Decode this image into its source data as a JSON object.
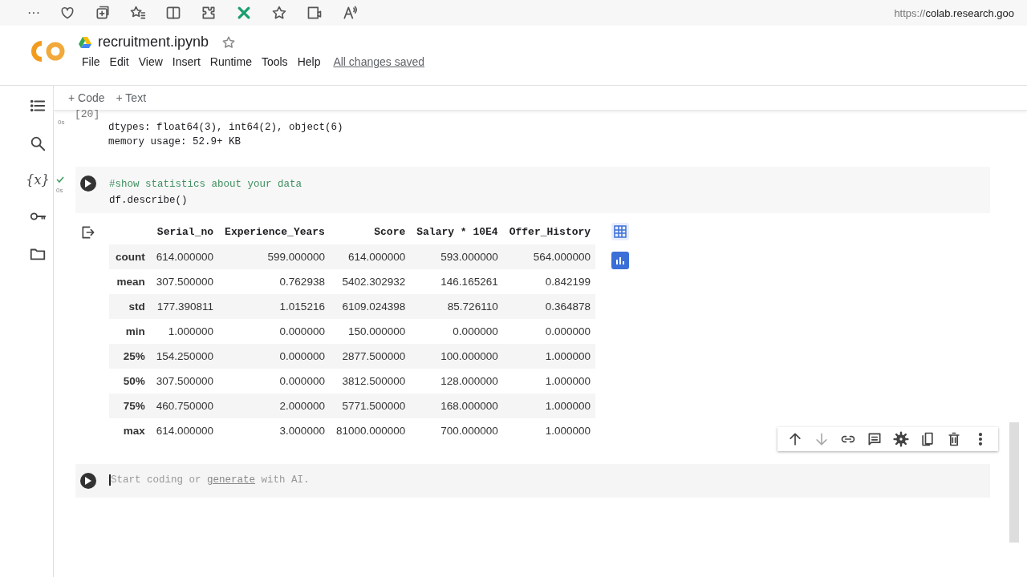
{
  "browser": {
    "menu_glyph": "···",
    "url_scheme": "https://",
    "url_host": "colab.research.goo"
  },
  "notebook": {
    "title": "recruitment.ipynb",
    "menu": [
      "File",
      "Edit",
      "View",
      "Insert",
      "Runtime",
      "Tools",
      "Help"
    ],
    "save_status": "All changes saved"
  },
  "sidebar": {
    "variables_glyph": "{x}"
  },
  "toolbar": [
    "+ Code",
    "+ Text"
  ],
  "prev_cell": {
    "exec_count": "[20]",
    "time": "0s",
    "lines": [
      "dtypes: float64(3), int64(2), object(6)",
      "memory usage: 52.9+ KB"
    ]
  },
  "code_cell": {
    "ran": true,
    "time": "0s",
    "comment": "#show statistics about your data",
    "code": "df.describe()",
    "table": {
      "columns": [
        "Serial_no",
        "Experience_Years",
        "Score",
        "Salary * 10E4",
        "Offer_History"
      ],
      "rows": [
        {
          "label": "count",
          "values": [
            "614.000000",
            "599.000000",
            "614.000000",
            "593.000000",
            "564.000000"
          ]
        },
        {
          "label": "mean",
          "values": [
            "307.500000",
            "0.762938",
            "5402.302932",
            "146.165261",
            "0.842199"
          ]
        },
        {
          "label": "std",
          "values": [
            "177.390811",
            "1.015216",
            "6109.024398",
            "85.726110",
            "0.364878"
          ]
        },
        {
          "label": "min",
          "values": [
            "1.000000",
            "0.000000",
            "150.000000",
            "0.000000",
            "0.000000"
          ]
        },
        {
          "label": "25%",
          "values": [
            "154.250000",
            "0.000000",
            "2877.500000",
            "100.000000",
            "1.000000"
          ]
        },
        {
          "label": "50%",
          "values": [
            "307.500000",
            "0.000000",
            "3812.500000",
            "128.000000",
            "1.000000"
          ]
        },
        {
          "label": "75%",
          "values": [
            "460.750000",
            "2.000000",
            "5771.500000",
            "168.000000",
            "1.000000"
          ]
        },
        {
          "label": "max",
          "values": [
            "614.000000",
            "3.000000",
            "81000.000000",
            "700.000000",
            "1.000000"
          ]
        }
      ]
    }
  },
  "empty_cell": {
    "placeholder_before": "Start coding or ",
    "placeholder_link": "generate",
    "placeholder_after": " with AI."
  },
  "cell_toolbar": [
    {
      "kind": "up",
      "disabled": false
    },
    {
      "kind": "down",
      "disabled": true
    },
    {
      "kind": "link",
      "disabled": false
    },
    {
      "kind": "comment",
      "disabled": false
    },
    {
      "kind": "gear",
      "disabled": false
    },
    {
      "kind": "copy",
      "disabled": false
    },
    {
      "kind": "trash",
      "disabled": false
    },
    {
      "kind": "more",
      "disabled": false
    }
  ]
}
